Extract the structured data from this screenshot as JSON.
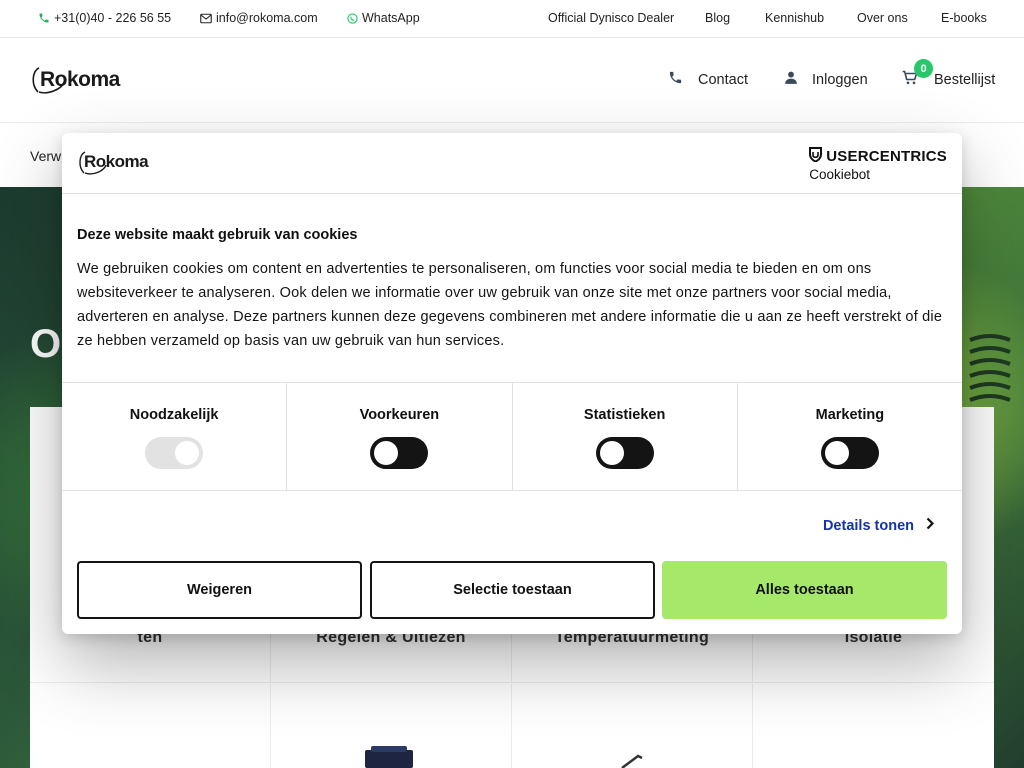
{
  "topbar": {
    "phone": "+31(0)40 - 226 56 55",
    "email": "info@rokoma.com",
    "whatsapp": "WhatsApp",
    "links": [
      "Official Dynisco Dealer",
      "Blog",
      "Kennishub",
      "Over ons",
      "E-books"
    ]
  },
  "header": {
    "logo": "Rokoma",
    "contact": "Contact",
    "login": "Inloggen",
    "cart_label": "Bestellijst",
    "cart_count": "0"
  },
  "subnav": {
    "text": "Verw"
  },
  "hero": {
    "title_fragment": "O",
    "cards": [
      "ten",
      "Regelen & Uitlezen",
      "Temperatuurmeting",
      "Isolatie"
    ]
  },
  "cookie": {
    "logo": "Rokoma",
    "provider_brand": "USERCENTRICS",
    "provider_sub": "Cookiebot",
    "title": "Deze website maakt gebruik van cookies",
    "body": "We gebruiken cookies om content en advertenties te personaliseren, om functies voor social media te bieden en om ons websiteverkeer te analyseren. Ook delen we informatie over uw gebruik van onze site met onze partners voor social media, adverteren en analyse. Deze partners kunnen deze gegevens combineren met andere informatie die u aan ze heeft verstrekt of die ze hebben verzameld op basis van uw gebruik van hun services.",
    "categories": [
      {
        "label": "Noodzakelijk",
        "checked": true,
        "disabled": true
      },
      {
        "label": "Voorkeuren",
        "checked": false,
        "disabled": false
      },
      {
        "label": "Statistieken",
        "checked": false,
        "disabled": false
      },
      {
        "label": "Marketing",
        "checked": false,
        "disabled": false
      }
    ],
    "details_label": "Details tonen",
    "buttons": {
      "reject": "Weigeren",
      "selection": "Selectie toestaan",
      "accept_all": "Alles toestaan"
    }
  },
  "colors": {
    "accent_green": "#a6e86a",
    "badge_green": "#27c86a",
    "link_blue": "#1532a8"
  }
}
